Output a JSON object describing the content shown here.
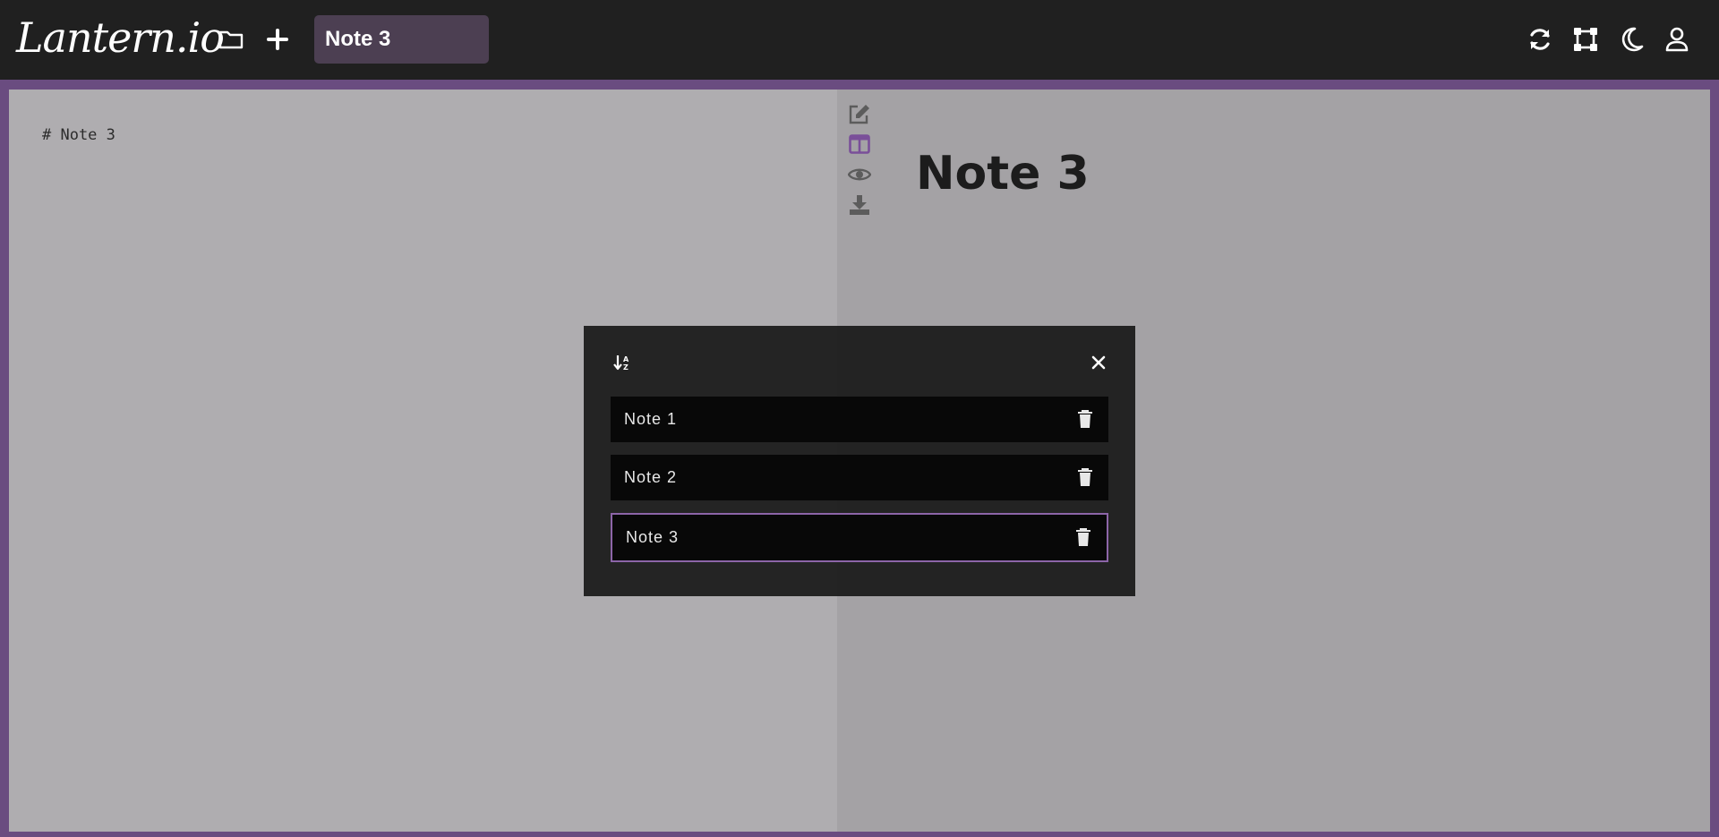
{
  "app": {
    "logo_text": "Lantern.io"
  },
  "toolbar": {
    "title_value": "Note 3",
    "icons": {
      "open": "folder-icon",
      "new": "plus-icon",
      "sync": "sync-icon",
      "fullscreen": "vector-square-icon",
      "theme": "moon-icon",
      "account": "user-icon"
    }
  },
  "editor": {
    "content": "# Note 3"
  },
  "preview": {
    "heading": "Note 3"
  },
  "view_tools": [
    "edit-icon",
    "split-view-icon",
    "preview-eye-icon",
    "download-icon"
  ],
  "notes_modal": {
    "sort_icon": "sort-alpha-icon",
    "close_icon": "close-icon",
    "notes": [
      {
        "label": "Note 1",
        "active": false
      },
      {
        "label": "Note 2",
        "active": false
      },
      {
        "label": "Note 3",
        "active": true
      }
    ]
  },
  "colors": {
    "accent": "#8c65a8",
    "topbar": "#202020",
    "frame": "#6a4c80"
  }
}
